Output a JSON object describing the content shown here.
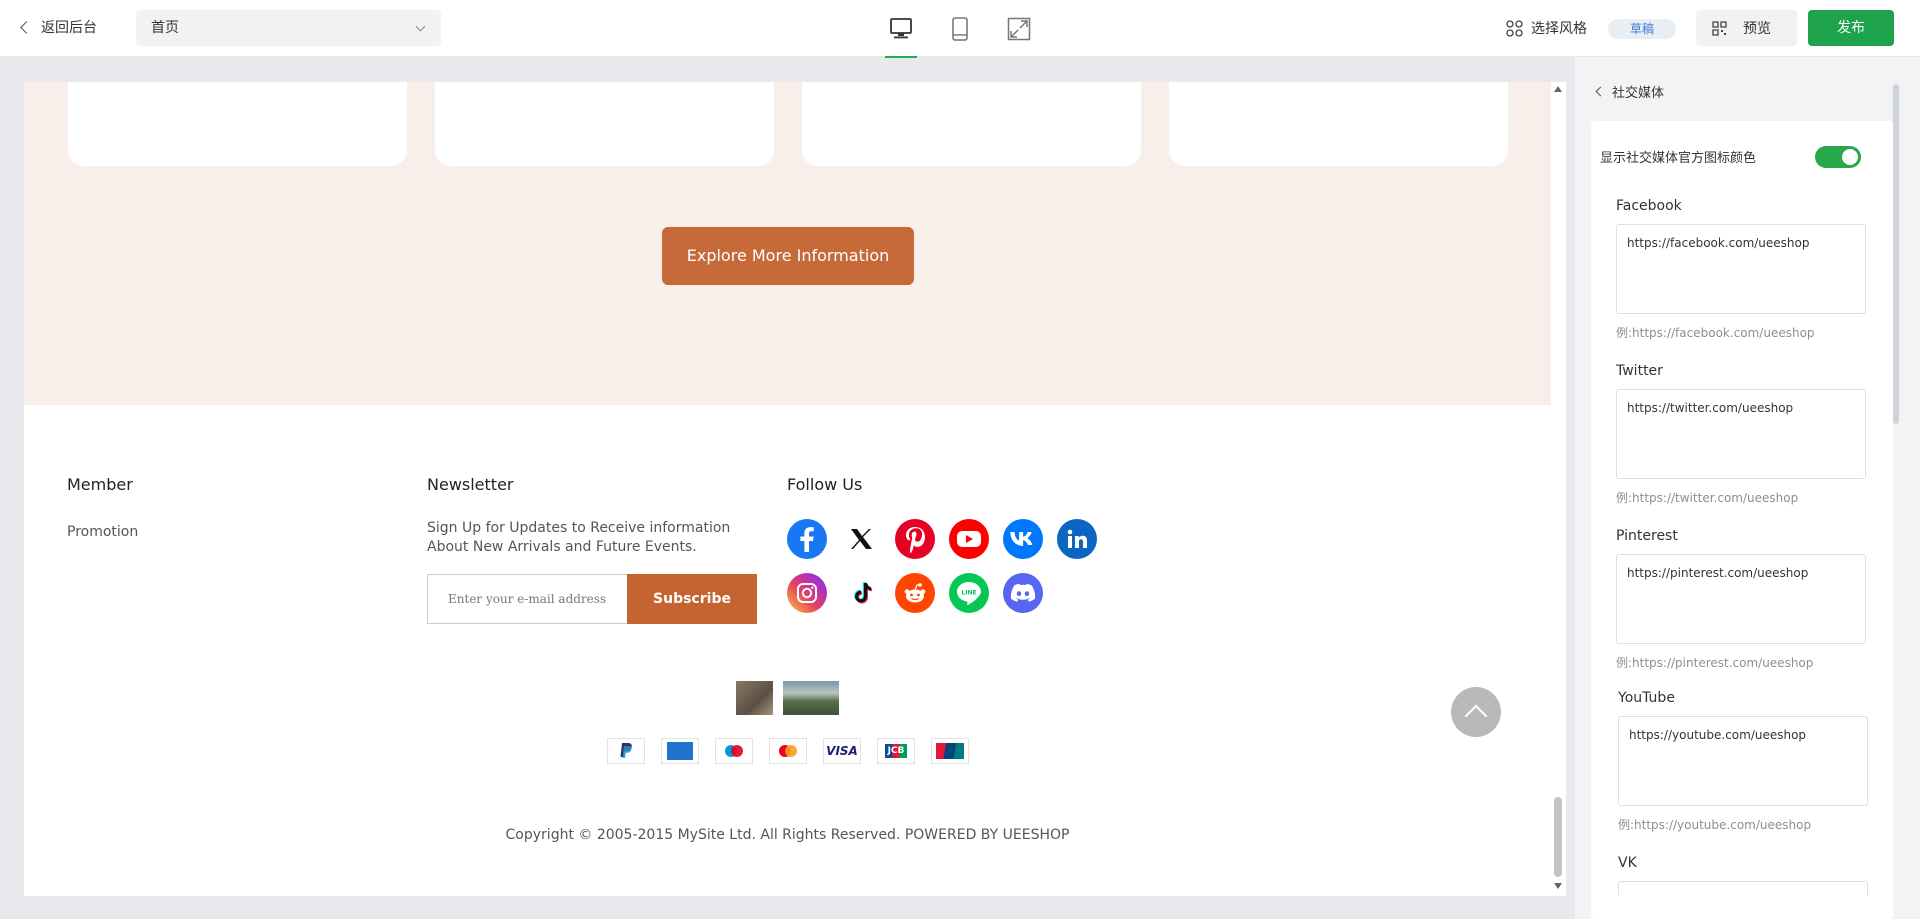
{
  "topbar": {
    "back_label": "返回后台",
    "page_select": "首页",
    "style_label": "选择风格",
    "draft_badge": "草稿",
    "preview_label": "预览",
    "publish_label": "发布"
  },
  "canvas": {
    "explore_button": "Explore More Information",
    "footer": {
      "member_heading": "Member",
      "member_link": "Promotion",
      "newsletter_heading": "Newsletter",
      "newsletter_text_1": "Sign Up for Updates to Receive information",
      "newsletter_text_2": "About New Arrivals and Future Events.",
      "email_placeholder": "Enter your e-mail address",
      "subscribe_label": "Subscribe",
      "follow_heading": "Follow Us",
      "social_icons": [
        "facebook",
        "x",
        "pinterest",
        "youtube",
        "vk",
        "linkedin",
        "instagram",
        "tiktok",
        "reddit",
        "line",
        "discord"
      ],
      "payment_icons": [
        "paypal",
        "amex",
        "maestro",
        "mastercard",
        "visa",
        "jcb",
        "unionpay"
      ],
      "visa_text": "VISA",
      "jcb_text": "JCB",
      "copyright": "Copyright © 2005-2015 MySite Ltd. All Rights Reserved. POWERED BY UEESHOP"
    }
  },
  "panel": {
    "title": "社交媒体",
    "toggle_label": "显示社交媒体官方图标颜色",
    "toggle_on": true,
    "fields": [
      {
        "label": "Facebook",
        "value": "https://facebook.com/ueeshop",
        "hint": "例:https://facebook.com/ueeshop"
      },
      {
        "label": "Twitter",
        "value": "https://twitter.com/ueeshop",
        "hint": "例:https://twitter.com/ueeshop"
      },
      {
        "label": "Pinterest",
        "value": "https://pinterest.com/ueeshop",
        "hint": "例:https://pinterest.com/ueeshop"
      },
      {
        "label": "YouTube",
        "value": "https://youtube.com/ueeshop",
        "hint": "例:https://youtube.com/ueeshop"
      },
      {
        "label": "VK",
        "value": "",
        "hint": ""
      }
    ]
  },
  "colors": {
    "accent_green": "#1fa34a",
    "brand_orange": "#c66a3a",
    "beige_section": "#f8efea"
  }
}
